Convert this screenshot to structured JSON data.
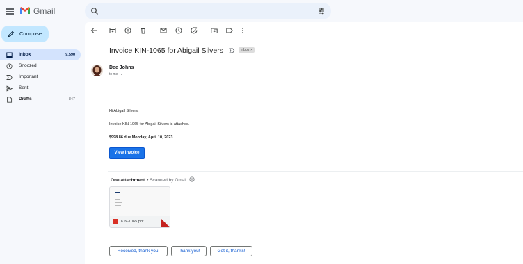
{
  "header": {
    "app_name": "Gmail",
    "search_placeholder": ""
  },
  "sidebar": {
    "compose_label": "Compose",
    "items": [
      {
        "label": "Inbox",
        "count": "9,590",
        "icon": "inbox-icon",
        "active": true
      },
      {
        "label": "Snoozed",
        "count": "",
        "icon": "clock-icon"
      },
      {
        "label": "Important",
        "count": "",
        "icon": "important-icon"
      },
      {
        "label": "Sent",
        "count": "",
        "icon": "send-icon"
      },
      {
        "label": "Drafts",
        "count": "847",
        "icon": "draft-icon"
      }
    ]
  },
  "toolbar": {
    "icons": [
      "back-arrow-icon",
      "archive-icon",
      "report-spam-icon",
      "delete-icon",
      "mark-unread-icon",
      "snooze-icon",
      "add-task-icon",
      "move-to-icon",
      "label-icon",
      "more-vert-icon"
    ]
  },
  "email": {
    "subject": "Invoice KIN-1065 for Abigail Silvers",
    "label_chip": "Inbox",
    "label_chip_close": "×",
    "sender": "Dee Johns",
    "recipient": "to me",
    "greeting": "Hi Abigail Silvers,",
    "line1": "Invoice KIN-1065 for Abigail Silvers is attached.",
    "amount_line": "$998.86 due Monday, April 10, 2023",
    "button_label": "View Invoice"
  },
  "attachments": {
    "heading": "One attachment",
    "scanned": "• Scanned by Gmail",
    "file_name": "KIN-1065.pdf"
  },
  "smart_replies": [
    "Received, thank you.",
    "Thank you!",
    "Got it, thanks!"
  ],
  "colors": {
    "accent": "#0b57d0",
    "compose_bg": "#c2e7ff",
    "active_nav": "#d3e3fd",
    "app_bg": "#f6f8fc"
  }
}
